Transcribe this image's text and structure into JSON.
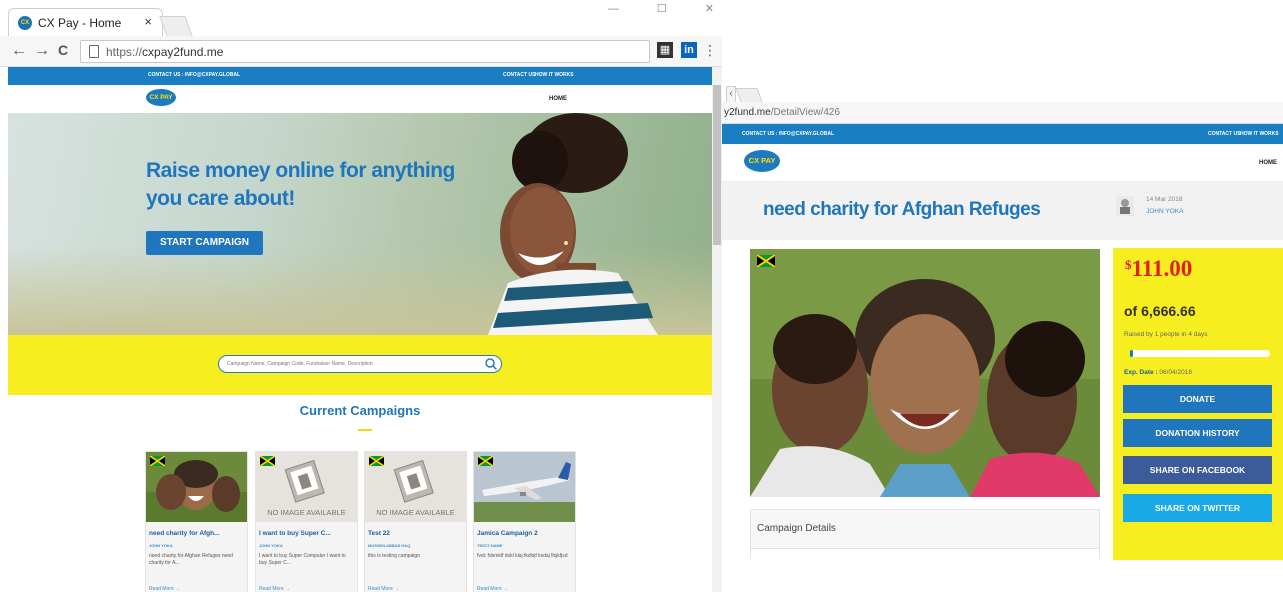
{
  "left_window": {
    "tab_title": "CX Pay - Home",
    "tab_close": "×",
    "favicon": "CX",
    "window_controls": [
      "—",
      "☐",
      "✕"
    ],
    "nav": {
      "back": "←",
      "forward": "→",
      "reload": "C"
    },
    "url_scheme": "https://",
    "url_host": "cxpay2fund.me",
    "extensions": [
      "film-icon",
      "linkedin-icon",
      "menu-icon"
    ],
    "site": {
      "contact": "CONTACT US : INFO@CXPAY.GLOBAL",
      "top_links": [
        "CONTACT US",
        "HOW IT WORKS"
      ],
      "logo": "CX PAY",
      "home": "HOME",
      "hero_title": "Raise money online for anything you care about!",
      "hero_button": "START CAMPAIGN",
      "search_placeholder": "Campaign Name, Campaign Code, Fundraiser Name, Description",
      "section_title": "Current Campaigns",
      "campaigns": [
        {
          "title": "need charity for Afgh...",
          "author": "JOHN YOKA",
          "desc": "need charity for Afghan Refuges need charity for A...",
          "more": "Read More →",
          "image": "family-photo"
        },
        {
          "title": "I want to buy Super C...",
          "author": "JOHN YOKA",
          "desc": "I want to buy Super Computer I want to buy Super C...",
          "more": "Read More →",
          "image": "no-image",
          "noimg_text": "NO IMAGE AVAILABLE"
        },
        {
          "title": "Test 22",
          "author": "MUSSEN ABBAS HAQ",
          "desc": "this is testing campaign",
          "more": "Read More →",
          "image": "no-image",
          "noimg_text": "NO IMAGE AVAILABLE"
        },
        {
          "title": "Jamica Campaign 2",
          "author": "TESTZ NAME",
          "desc": "fvdc fdsmklf dskl klaj fkdlsjf ksdaj lfsjkfjsd",
          "more": "Read More →",
          "image": "airplane-photo"
        }
      ]
    }
  },
  "right_window": {
    "url_host": "y2fund.me",
    "url_path": "/DetailView/426",
    "contact": "CONTACT US : INFO@CXPAY.GLOBAL",
    "top_links": [
      "CONTACT US",
      "HOW IT WORKS"
    ],
    "logo": "CX PAY",
    "home": "HOME",
    "campaign_title": "need charity for Afghan Refuges",
    "date": "14 Mar 2018",
    "author": "JOHN YOKA",
    "currency": "$",
    "amount": "111.00",
    "goal": "of 6,666.66",
    "raised_text": "Raised by 1 people in 4 days",
    "progress_fraction": 0.017,
    "exp_label": "Exp. Date :",
    "exp_value": "06/04/2018",
    "buttons": [
      {
        "label": "DONATE",
        "color": "#1f76bd"
      },
      {
        "label": "DONATION HISTORY",
        "color": "#1f76bd"
      },
      {
        "label": "SHARE ON FACEBOOK",
        "color": "#3b5c99"
      },
      {
        "label": "SHARE ON TWITTER",
        "color": "#19a9e6"
      }
    ],
    "details_label": "Campaign Details"
  },
  "colors": {
    "brand_blue": "#1a7ec2",
    "brand_yellow": "#f7ee1f",
    "amount_red": "#e21f1f"
  }
}
